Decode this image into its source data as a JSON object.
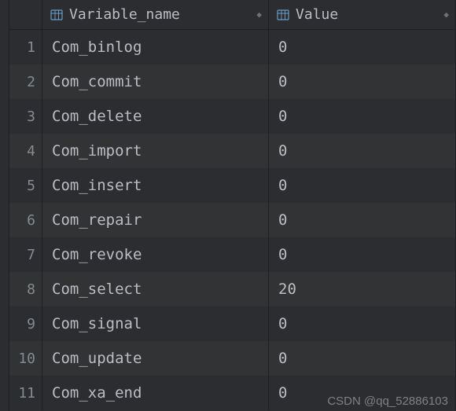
{
  "columns": {
    "variable_name": {
      "label": "Variable_name"
    },
    "value": {
      "label": "Value"
    }
  },
  "rows": [
    {
      "n": "1",
      "variable_name": "Com_binlog",
      "value": "0"
    },
    {
      "n": "2",
      "variable_name": "Com_commit",
      "value": "0"
    },
    {
      "n": "3",
      "variable_name": "Com_delete",
      "value": "0"
    },
    {
      "n": "4",
      "variable_name": "Com_import",
      "value": "0"
    },
    {
      "n": "5",
      "variable_name": "Com_insert",
      "value": "0"
    },
    {
      "n": "6",
      "variable_name": "Com_repair",
      "value": "0"
    },
    {
      "n": "7",
      "variable_name": "Com_revoke",
      "value": "0"
    },
    {
      "n": "8",
      "variable_name": "Com_select",
      "value": "20"
    },
    {
      "n": "9",
      "variable_name": "Com_signal",
      "value": "0"
    },
    {
      "n": "10",
      "variable_name": "Com_update",
      "value": "0"
    },
    {
      "n": "11",
      "variable_name": "Com_xa_end",
      "value": "0"
    }
  ],
  "watermark": "CSDN @qq_52886103"
}
